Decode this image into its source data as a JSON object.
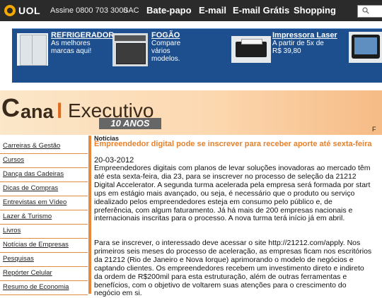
{
  "topbar": {
    "brand": "UOL",
    "assine": "Assine 0800 703 3000",
    "sac": "SAC",
    "links": [
      "Bate-papo",
      "E-mail",
      "E-mail Grátis",
      "Shopping"
    ]
  },
  "ad": {
    "items": [
      {
        "title": "REFRIGERADOR",
        "desc": "As melhores marcas aqui!"
      },
      {
        "title": "FOGÃO",
        "desc": "Compare vários modelos."
      },
      {
        "title": "Impressora Laser",
        "desc": "A partir de 5x de R$ 39,80"
      }
    ]
  },
  "brand": {
    "c": "C",
    "ana": "ana",
    "l": "l",
    "exec": "Executivo",
    "anos": "10 ANOS",
    "f": "F"
  },
  "sidebar": {
    "items": [
      "Carreiras & Gestão",
      "Cursos",
      "Dança das Cadeiras",
      "Dicas de Compras",
      "Entrevistas em Vídeo",
      "Lazer & Turismo",
      "Livros",
      "Notícias de Empresas",
      "Pesquisas",
      "Repórter Celular",
      "Resumo de Economia"
    ]
  },
  "article": {
    "section": "Notícias",
    "headline": "Empreendedor digital pode se inscrever para receber aporte até sexta-feira",
    "date": "20-03-2012",
    "p1": "Empreendedores digitais com planos de levar soluções inovadoras ao mercado têm até esta sexta-feira, dia 23, para se inscrever no processo de seleção da 21212 Digital Accelerator. A segunda turma acelerada pela empresa será formada por start ups em estágio mais avançado, ou seja, é necessário que o produto ou serviço idealizado pelos empreendedores esteja em consumo pelo público e, de preferência, com algum faturamento. Já há mais de 200 empresas nacionais e internacionais inscritas para o processo. A nova turma terá início já em abril.",
    "p2": "Para se inscrever, o interessado deve acessar o site http://21212.com/apply. Nos primeiros seis meses do processo de aceleração, as empresas ficam nos escritórios da 21212 (Rio de Janeiro e Nova Iorque) aprimorando o modelo de negócios e captando clientes. Os empreendedores recebem um investimento direto e indireto da ordem de R$200mil para esta estruturação, além de outras ferramentas e benefícios, com o objetivo de voltarem suas atenções para o crescimento do negócio em si."
  }
}
